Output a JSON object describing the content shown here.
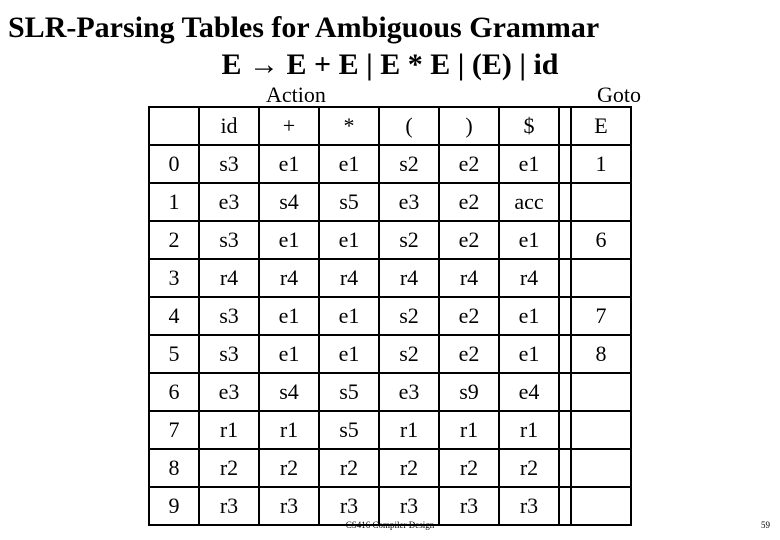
{
  "title": "SLR-Parsing Tables for Ambiguous Grammar",
  "grammar": "E → E + E | E * E | (E) | id",
  "labels": {
    "action": "Action",
    "goto": "Goto"
  },
  "chart_data": {
    "type": "table",
    "title": "SLR-Parsing Tables for Ambiguous Grammar",
    "action_columns": [
      "id",
      "+",
      "*",
      "(",
      ")",
      "$"
    ],
    "goto_columns": [
      "E"
    ],
    "states": [
      "0",
      "1",
      "2",
      "3",
      "4",
      "5",
      "6",
      "7",
      "8",
      "9"
    ],
    "action": [
      [
        "s3",
        "e1",
        "e1",
        "s2",
        "e2",
        "e1"
      ],
      [
        "e3",
        "s4",
        "s5",
        "e3",
        "e2",
        "acc"
      ],
      [
        "s3",
        "e1",
        "e1",
        "s2",
        "e2",
        "e1"
      ],
      [
        "r4",
        "r4",
        "r4",
        "r4",
        "r4",
        "r4"
      ],
      [
        "s3",
        "e1",
        "e1",
        "s2",
        "e2",
        "e1"
      ],
      [
        "s3",
        "e1",
        "e1",
        "s2",
        "e2",
        "e1"
      ],
      [
        "e3",
        "s4",
        "s5",
        "e3",
        "s9",
        "e4"
      ],
      [
        "r1",
        "r1",
        "s5",
        "r1",
        "r1",
        "r1"
      ],
      [
        "r2",
        "r2",
        "r2",
        "r2",
        "r2",
        "r2"
      ],
      [
        "r3",
        "r3",
        "r3",
        "r3",
        "r3",
        "r3"
      ]
    ],
    "goto": [
      [
        "1"
      ],
      [
        ""
      ],
      [
        "6"
      ],
      [
        ""
      ],
      [
        "7"
      ],
      [
        "8"
      ],
      [
        ""
      ],
      [
        ""
      ],
      [
        ""
      ],
      [
        ""
      ]
    ]
  },
  "footer": "CS416 Compiler Design",
  "page_number": "59"
}
